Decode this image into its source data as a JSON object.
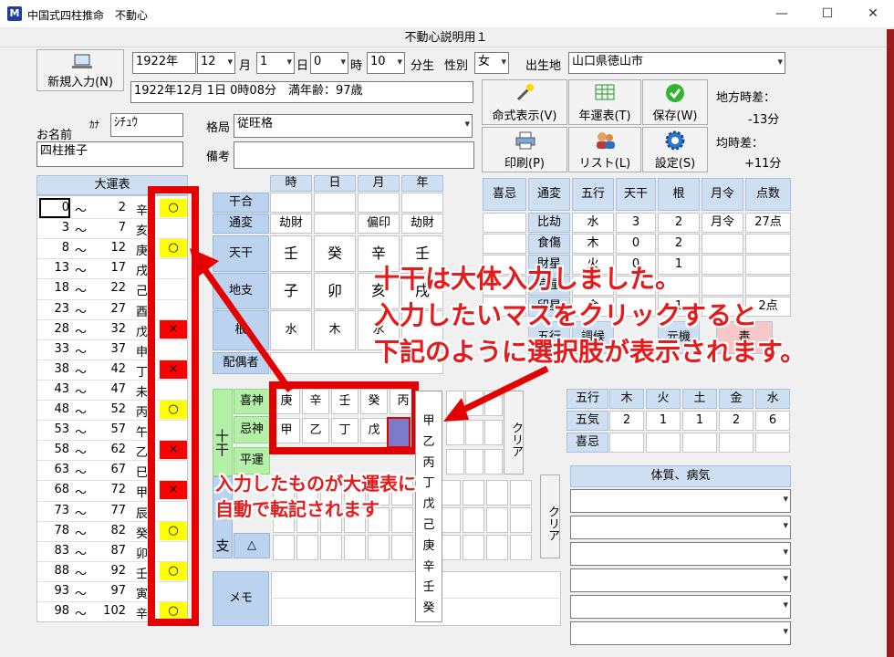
{
  "window": {
    "title": "中国式四柱推命　不動心",
    "icon": "M",
    "form_title": "不動心説明用１"
  },
  "toolbar": {
    "new_button": "新規入力(N)",
    "year": "1922年",
    "month": "12",
    "month_unit": "月",
    "day": "1",
    "day_unit": "日",
    "hour": "0",
    "hour_unit": "時",
    "minute": "10",
    "minute_unit": "分生",
    "gender_label": "性別",
    "gender": "女",
    "birthplace_label": "出生地",
    "birthplace": "山口県徳山市",
    "summary": "1922年12月 1日 0時08分　満年齢：97歳"
  },
  "actions": [
    {
      "label": "命式表示(V)",
      "icon": "wand-icon"
    },
    {
      "label": "年運表(T)",
      "icon": "table-icon"
    },
    {
      "label": "保存(W)",
      "icon": "check-icon"
    },
    {
      "label": "印刷(P)",
      "icon": "printer-icon"
    },
    {
      "label": "リスト(L)",
      "icon": "users-icon"
    },
    {
      "label": "設定(S)",
      "icon": "gear-icon"
    }
  ],
  "time_diff": {
    "local_label": "地方時差：",
    "local_value": "-13分",
    "eq_label": "均時差：",
    "eq_value": "+11分"
  },
  "person": {
    "name_label": "お名前",
    "kana_label": "ｶﾅ",
    "kana": "ｼﾁｭｳ",
    "name": "四柱推子",
    "kakkyoku_label": "格局",
    "kakkyoku": "従旺格",
    "biko_label": "備考",
    "biko": ""
  },
  "daiun": {
    "title": "大運表",
    "rows": [
      {
        "a": "0",
        "b": "2",
        "k": "辛",
        "m": "○"
      },
      {
        "a": "3",
        "b": "7",
        "k": "亥",
        "m": ""
      },
      {
        "a": "8",
        "b": "12",
        "k": "庚",
        "m": "○"
      },
      {
        "a": "13",
        "b": "17",
        "k": "戌",
        "m": ""
      },
      {
        "a": "18",
        "b": "22",
        "k": "己",
        "m": ""
      },
      {
        "a": "23",
        "b": "27",
        "k": "酉",
        "m": ""
      },
      {
        "a": "28",
        "b": "32",
        "k": "戊",
        "m": "×"
      },
      {
        "a": "33",
        "b": "37",
        "k": "申",
        "m": ""
      },
      {
        "a": "38",
        "b": "42",
        "k": "丁",
        "m": "×"
      },
      {
        "a": "43",
        "b": "47",
        "k": "未",
        "m": ""
      },
      {
        "a": "48",
        "b": "52",
        "k": "丙",
        "m": "○"
      },
      {
        "a": "53",
        "b": "57",
        "k": "午",
        "m": ""
      },
      {
        "a": "58",
        "b": "62",
        "k": "乙",
        "m": "×"
      },
      {
        "a": "63",
        "b": "67",
        "k": "巳",
        "m": ""
      },
      {
        "a": "68",
        "b": "72",
        "k": "甲",
        "m": "×"
      },
      {
        "a": "73",
        "b": "77",
        "k": "辰",
        "m": ""
      },
      {
        "a": "78",
        "b": "82",
        "k": "癸",
        "m": "○"
      },
      {
        "a": "83",
        "b": "87",
        "k": "卯",
        "m": ""
      },
      {
        "a": "88",
        "b": "92",
        "k": "壬",
        "m": "○"
      },
      {
        "a": "93",
        "b": "97",
        "k": "寅",
        "m": ""
      },
      {
        "a": "98",
        "b": "102",
        "k": "辛",
        "m": "○"
      }
    ],
    "tilde": "～"
  },
  "meishiki": {
    "cols": [
      "時",
      "日",
      "月",
      "年"
    ],
    "rows": {
      "kango": {
        "label": "干合",
        "vals": [
          "",
          "",
          "",
          ""
        ]
      },
      "tsuhen": {
        "label": "通変",
        "vals": [
          "劫財",
          "",
          "偏印",
          "劫財"
        ]
      },
      "tenkan": {
        "label": "天干",
        "vals": [
          "壬",
          "癸",
          "辛",
          "壬"
        ]
      },
      "chishi": {
        "label": "地支",
        "vals": [
          "子",
          "卯",
          "亥",
          "戌"
        ]
      },
      "ne": {
        "label": "根",
        "vals": [
          "水",
          "木",
          "水",
          ""
        ]
      },
      "haigu": {
        "label": "配偶者"
      }
    }
  },
  "jikkan": {
    "side_label": "十干",
    "kishin": "喜神",
    "imigami": "忌神",
    "heiun": "平運",
    "kishin_vals": [
      "庚",
      "辛",
      "壬",
      "癸",
      "丙"
    ],
    "imigami_vals": [
      "甲",
      "乙",
      "丁",
      "戊",
      ""
    ],
    "clear": "クリア",
    "options": [
      "甲",
      "乙",
      "丙",
      "丁",
      "戊",
      "己",
      "庚",
      "辛",
      "壬",
      "癸"
    ]
  },
  "junishi": {
    "side_label": "支",
    "triangle": "△",
    "clear": "クリア"
  },
  "memo": {
    "label": "メモ"
  },
  "gogyo_table": {
    "headers": [
      "喜忌",
      "通変",
      "五行",
      "天干",
      "根",
      "月令",
      "点数"
    ],
    "rows": [
      [
        "",
        "比劫",
        "水",
        "3",
        "2",
        "月令",
        "27点"
      ],
      [
        "",
        "食傷",
        "木",
        "0",
        "2",
        "",
        ""
      ],
      [
        "",
        "財星",
        "火",
        "0",
        "1",
        "",
        ""
      ],
      [
        "",
        "官星",
        "土",
        "",
        "",
        "",
        ""
      ],
      [
        "",
        "印星",
        "金",
        "",
        "1",
        "",
        "2点"
      ]
    ]
  },
  "misc_row": [
    "五行",
    "調候",
    "元機",
    "毒"
  ],
  "gokou": {
    "headers": [
      "五行",
      "木",
      "火",
      "土",
      "金",
      "水"
    ],
    "qi_label": "五気",
    "qi": [
      "2",
      "1",
      "1",
      "2",
      "6"
    ],
    "kiki_label": "喜忌"
  },
  "taishitsu": {
    "title": "体質、病気"
  },
  "annotations": {
    "main": [
      "十干は大体入力しました。",
      "入力したいマスをクリックすると",
      "下記のように選択肢が表示されます。"
    ],
    "sub": [
      "入力したものが大運表に",
      "自動で転記されます"
    ]
  }
}
